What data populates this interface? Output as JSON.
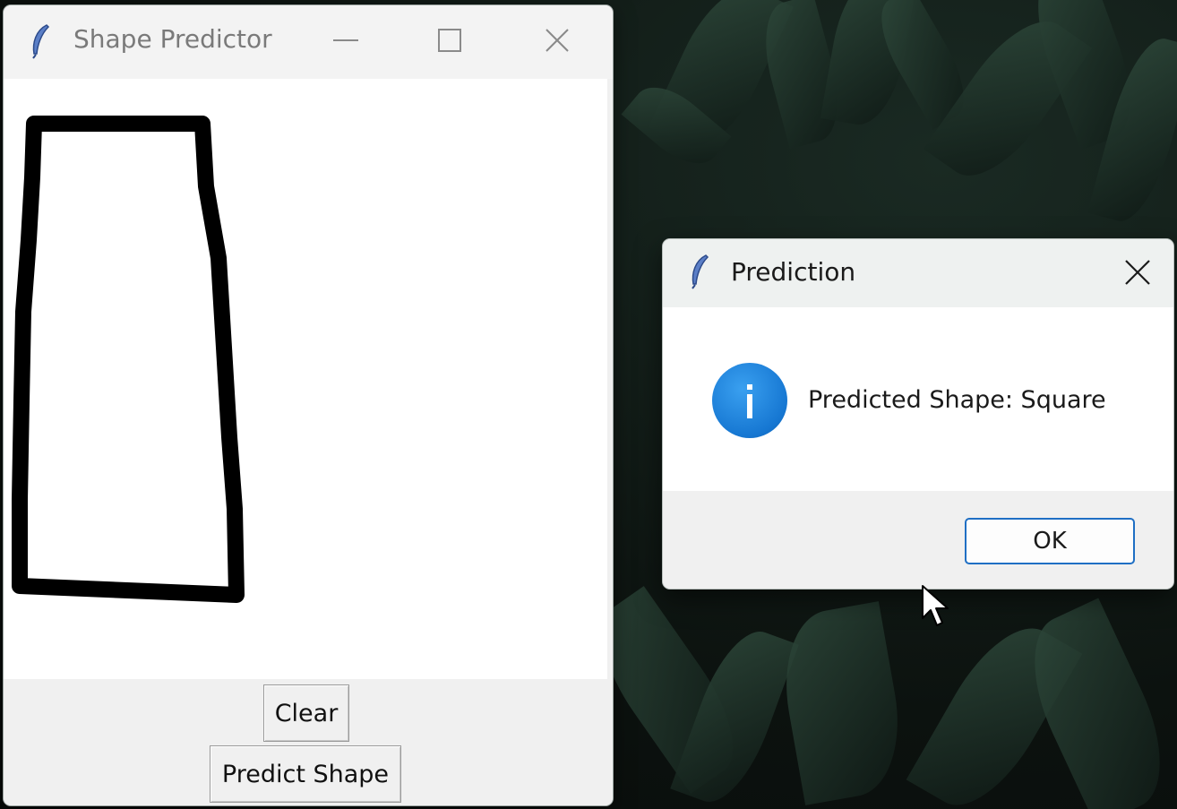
{
  "main_window": {
    "title": "Shape Predictor",
    "buttons": {
      "clear": "Clear",
      "predict": "Predict Shape"
    },
    "icons": {
      "app": "feather-icon",
      "minimize": "minimize-icon",
      "maximize": "maximize-icon",
      "close": "close-icon"
    }
  },
  "dialog": {
    "title": "Prediction",
    "message": "Predicted Shape: Square",
    "ok_label": "OK",
    "icons": {
      "app": "feather-icon",
      "info": "info-icon",
      "close": "close-icon"
    }
  },
  "colors": {
    "info_blue": "#1677d2",
    "focus_border": "#1f6fc4",
    "stroke": "#000000"
  }
}
